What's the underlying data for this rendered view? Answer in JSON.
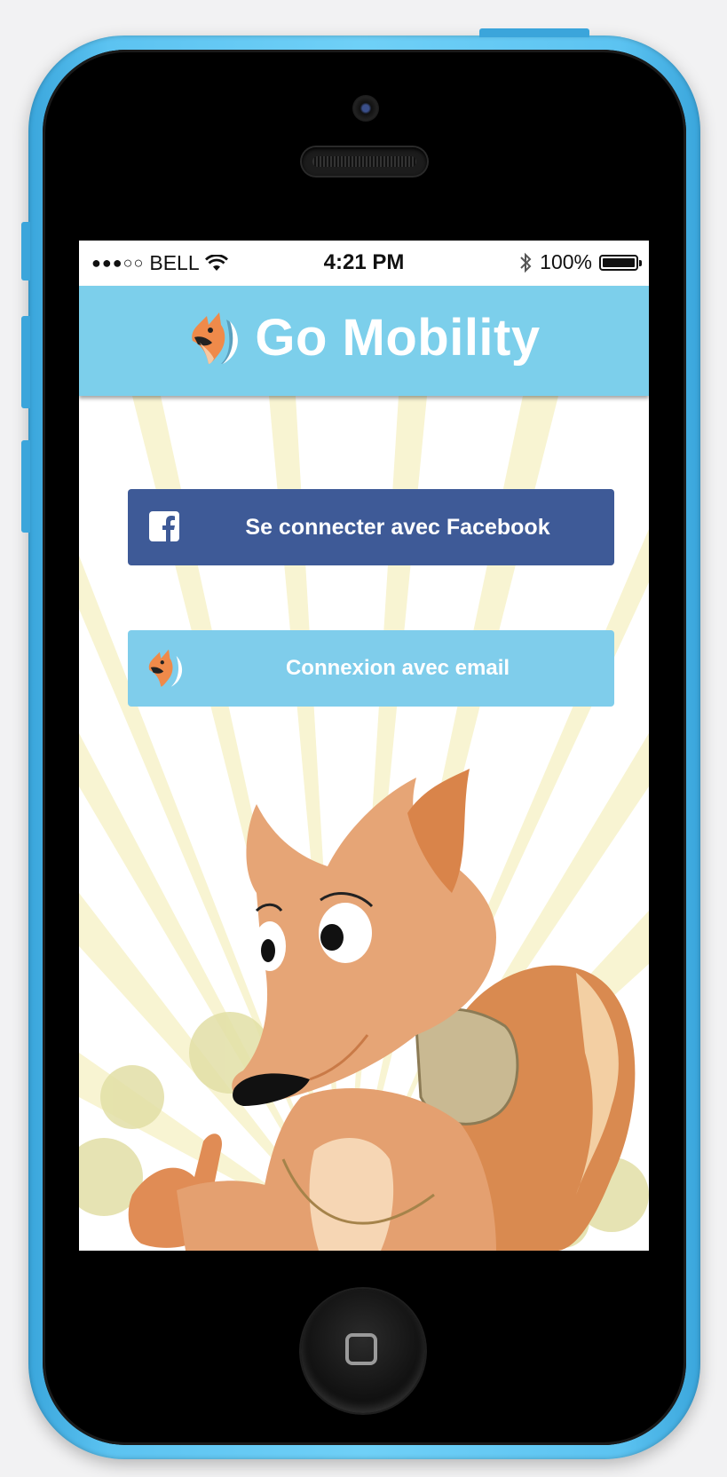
{
  "status_bar": {
    "signal": "●●●○○",
    "carrier": "BELL",
    "time": "4:21 PM",
    "battery": "100%",
    "icons": [
      "wifi-icon",
      "bluetooth-icon",
      "battery-icon"
    ]
  },
  "app_bar": {
    "title": "Go Mobility",
    "logo": "fox-logo-icon"
  },
  "buttons": {
    "facebook_label": "Se connecter avec Facebook",
    "email_label": "Connexion avec email"
  },
  "colors": {
    "app_bar": "#7ccfeb",
    "facebook": "#3e5a97",
    "email_button": "#7fcdeb",
    "phone_case": "#5cc3f1",
    "rays": "#f8f4d2"
  }
}
